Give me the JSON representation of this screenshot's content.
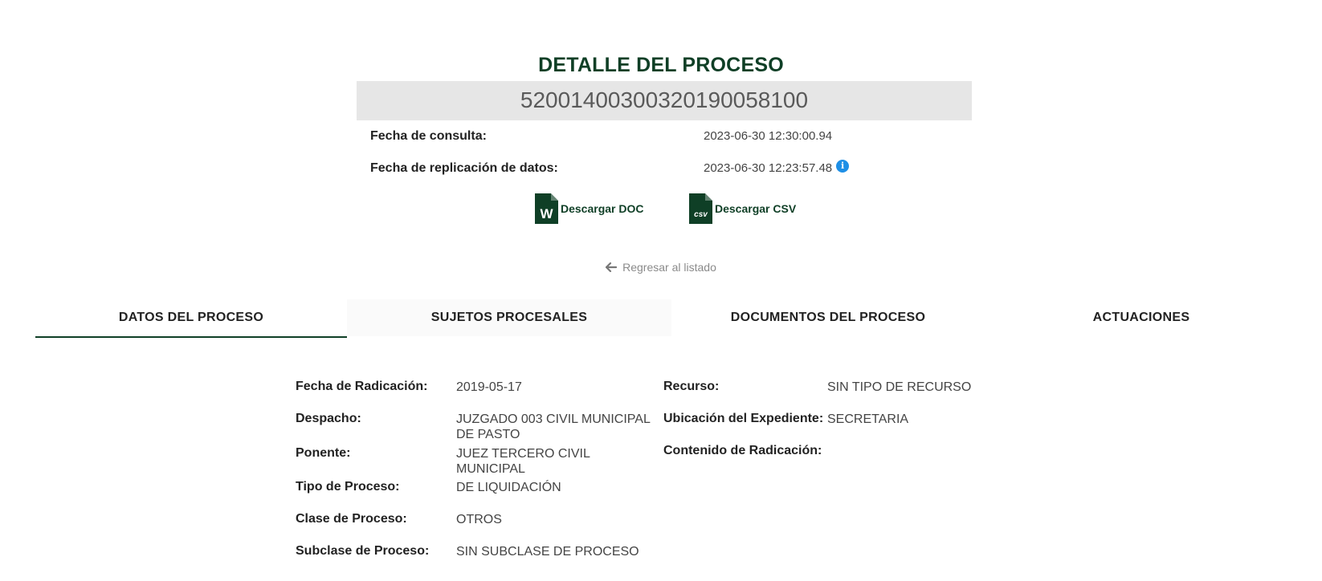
{
  "header": {
    "title": "DETALLE DEL PROCESO",
    "process_number": "52001400300320190058100"
  },
  "meta": {
    "consulta_label": "Fecha de consulta:",
    "consulta_value": "2023-06-30 12:30:00.94",
    "replicacion_label": "Fecha de replicación de datos:",
    "replicacion_value": "2023-06-30 12:23:57.48"
  },
  "downloads": {
    "doc_label": "Descargar DOC",
    "doc_icon": "word-file-icon",
    "csv_label": "Descargar CSV",
    "csv_icon": "csv-file-icon"
  },
  "nav": {
    "back_label": "Regresar al listado"
  },
  "tabs": [
    {
      "label": "DATOS DEL PROCESO",
      "active": true
    },
    {
      "label": "SUJETOS PROCESALES",
      "active": false
    },
    {
      "label": "DOCUMENTOS DEL PROCESO",
      "active": false
    },
    {
      "label": "ACTUACIONES",
      "active": false
    }
  ],
  "details": {
    "left": [
      {
        "label": "Fecha de Radicación:",
        "value": "2019-05-17"
      },
      {
        "label": "Despacho:",
        "value_lines": [
          "JUZGADO 003 CIVIL MUNICIPAL",
          "DE PASTO"
        ]
      },
      {
        "label": "Ponente:",
        "value_lines": [
          "JUEZ TERCERO CIVIL",
          "MUNICIPAL"
        ]
      },
      {
        "label": "Tipo de Proceso:",
        "value": "DE LIQUIDACIÓN"
      },
      {
        "label": "Clase de Proceso:",
        "value": "OTROS"
      },
      {
        "label": "Subclase de Proceso:",
        "value": "SIN SUBCLASE DE PROCESO"
      }
    ],
    "right": [
      {
        "label": "Recurso:",
        "value": "SIN TIPO DE RECURSO"
      },
      {
        "label": "Ubicación del Expediente:",
        "value": "SECRETARIA"
      },
      {
        "label": "Contenido de Radicación:",
        "value": ""
      }
    ]
  },
  "colors": {
    "brand_green": "#0f3f26",
    "info_blue": "#1e8fe6",
    "number_box_bg": "#e6e6e6"
  }
}
